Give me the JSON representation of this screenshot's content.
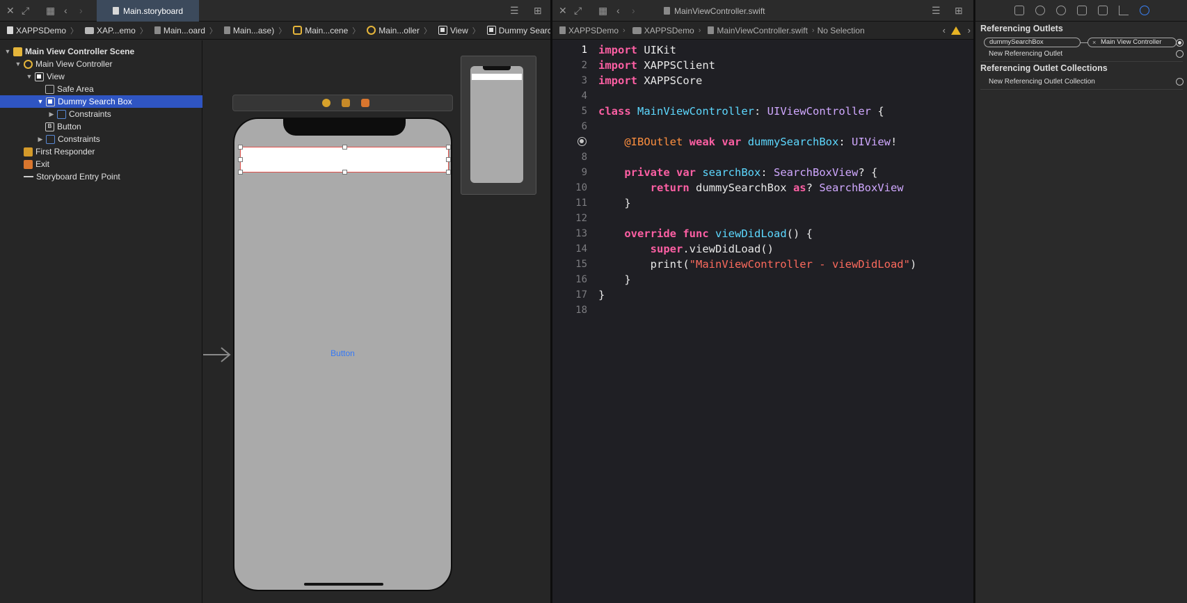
{
  "storyboard": {
    "tab_title": "Main.storyboard",
    "breadcrumb": [
      "XAPPSDemo",
      "XAP...emo",
      "Main...oard",
      "Main...ase)",
      "Main...cene",
      "Main...oller",
      "View",
      "Dummy Search Box"
    ],
    "outline": [
      {
        "label": "Main View Controller Scene",
        "level": 0,
        "icon": "scene-icon",
        "chevron": "expanded"
      },
      {
        "label": "Main View Controller",
        "level": 1,
        "icon": "view-controller-icon",
        "chevron": "expanded"
      },
      {
        "label": "View",
        "level": 2,
        "icon": "view-icon",
        "chevron": "expanded"
      },
      {
        "label": "Safe Area",
        "level": 3,
        "icon": "safe-area-icon",
        "chevron": "none"
      },
      {
        "label": "Dummy Search Box",
        "level": 3,
        "icon": "view-icon",
        "chevron": "expanded",
        "selected": true
      },
      {
        "label": "Constraints",
        "level": 4,
        "icon": "constraint-icon",
        "chevron": "collapsed"
      },
      {
        "label": "Button",
        "level": 3,
        "icon": "button-icon",
        "chevron": "none"
      },
      {
        "label": "Constraints",
        "level": 3,
        "icon": "constraint-icon",
        "chevron": "collapsed"
      },
      {
        "label": "First Responder",
        "level": 1,
        "icon": "first-responder-icon",
        "chevron": "none"
      },
      {
        "label": "Exit",
        "level": 1,
        "icon": "exit-icon",
        "chevron": "none"
      },
      {
        "label": "Storyboard Entry Point",
        "level": 1,
        "icon": "entry-point-icon",
        "chevron": "none"
      }
    ],
    "canvas_button_label": "Button"
  },
  "editor": {
    "tab_title": "MainViewController.swift",
    "breadcrumb": [
      "XAPPSDemo",
      "XAPPSDemo",
      "MainViewController.swift",
      "No Selection"
    ],
    "active_line": 1,
    "lines": [
      {
        "n": "1",
        "tokens": [
          {
            "t": "import",
            "c": "kw"
          },
          {
            "t": " UIKit",
            "c": "plain"
          }
        ]
      },
      {
        "n": "2",
        "tokens": [
          {
            "t": "import",
            "c": "kw"
          },
          {
            "t": " XAPPSClient",
            "c": "plain"
          }
        ]
      },
      {
        "n": "3",
        "tokens": [
          {
            "t": "import",
            "c": "kw"
          },
          {
            "t": " XAPPSCore",
            "c": "plain"
          }
        ]
      },
      {
        "n": "4",
        "tokens": []
      },
      {
        "n": "5",
        "tokens": [
          {
            "t": "class",
            "c": "kw"
          },
          {
            "t": " ",
            "c": "plain"
          },
          {
            "t": "MainViewController",
            "c": "type"
          },
          {
            "t": ": ",
            "c": "plain"
          },
          {
            "t": "UIViewController",
            "c": "typeref"
          },
          {
            "t": " {",
            "c": "plain"
          }
        ]
      },
      {
        "n": "6",
        "tokens": []
      },
      {
        "n": "7",
        "outlet": true,
        "tokens": [
          {
            "t": "    ",
            "c": "plain"
          },
          {
            "t": "@IBOutlet",
            "c": "attr"
          },
          {
            "t": " ",
            "c": "plain"
          },
          {
            "t": "weak",
            "c": "kw"
          },
          {
            "t": " ",
            "c": "plain"
          },
          {
            "t": "var",
            "c": "kw"
          },
          {
            "t": " ",
            "c": "plain"
          },
          {
            "t": "dummySearchBox",
            "c": "type"
          },
          {
            "t": ": ",
            "c": "plain"
          },
          {
            "t": "UIView",
            "c": "typeref"
          },
          {
            "t": "!",
            "c": "plain"
          }
        ]
      },
      {
        "n": "8",
        "tokens": []
      },
      {
        "n": "9",
        "tokens": [
          {
            "t": "    ",
            "c": "plain"
          },
          {
            "t": "private",
            "c": "kw"
          },
          {
            "t": " ",
            "c": "plain"
          },
          {
            "t": "var",
            "c": "kw"
          },
          {
            "t": " ",
            "c": "plain"
          },
          {
            "t": "searchBox",
            "c": "type"
          },
          {
            "t": ": ",
            "c": "plain"
          },
          {
            "t": "SearchBoxView",
            "c": "typeref"
          },
          {
            "t": "? {",
            "c": "plain"
          }
        ]
      },
      {
        "n": "10",
        "tokens": [
          {
            "t": "        ",
            "c": "plain"
          },
          {
            "t": "return",
            "c": "kw"
          },
          {
            "t": " dummySearchBox ",
            "c": "plain"
          },
          {
            "t": "as",
            "c": "kw"
          },
          {
            "t": "? ",
            "c": "plain"
          },
          {
            "t": "SearchBoxView",
            "c": "typeref"
          }
        ]
      },
      {
        "n": "11",
        "tokens": [
          {
            "t": "    }",
            "c": "plain"
          }
        ]
      },
      {
        "n": "12",
        "tokens": []
      },
      {
        "n": "13",
        "tokens": [
          {
            "t": "    ",
            "c": "plain"
          },
          {
            "t": "override",
            "c": "kw"
          },
          {
            "t": " ",
            "c": "plain"
          },
          {
            "t": "func",
            "c": "kw"
          },
          {
            "t": " ",
            "c": "plain"
          },
          {
            "t": "viewDidLoad",
            "c": "type"
          },
          {
            "t": "() {",
            "c": "plain"
          }
        ]
      },
      {
        "n": "14",
        "tokens": [
          {
            "t": "        ",
            "c": "plain"
          },
          {
            "t": "super",
            "c": "kw"
          },
          {
            "t": ".viewDidLoad()",
            "c": "plain"
          }
        ]
      },
      {
        "n": "15",
        "tokens": [
          {
            "t": "        print(",
            "c": "plain"
          },
          {
            "t": "\"MainViewController - viewDidLoad\"",
            "c": "str"
          },
          {
            "t": ")",
            "c": "plain"
          }
        ]
      },
      {
        "n": "16",
        "tokens": [
          {
            "t": "    }",
            "c": "plain"
          }
        ]
      },
      {
        "n": "17",
        "tokens": [
          {
            "t": "}",
            "c": "plain"
          }
        ]
      },
      {
        "n": "18",
        "tokens": []
      }
    ]
  },
  "inspector": {
    "outlets_heading": "Referencing Outlets",
    "outlet_name": "dummySearchBox",
    "outlet_target": "Main View Controller",
    "new_outlet_label": "New Referencing Outlet",
    "collections_heading": "Referencing Outlet Collections",
    "new_collection_label": "New Referencing Outlet Collection"
  },
  "colors": {
    "selection": "#2f55c3",
    "keyword": "#fc5fa3",
    "type_decl": "#5dd8ff",
    "type_ref": "#d0a8ff",
    "string": "#fc6a5d",
    "attribute": "#fd8f3f",
    "warning": "#e6b324",
    "system_blue": "#3478f6"
  }
}
